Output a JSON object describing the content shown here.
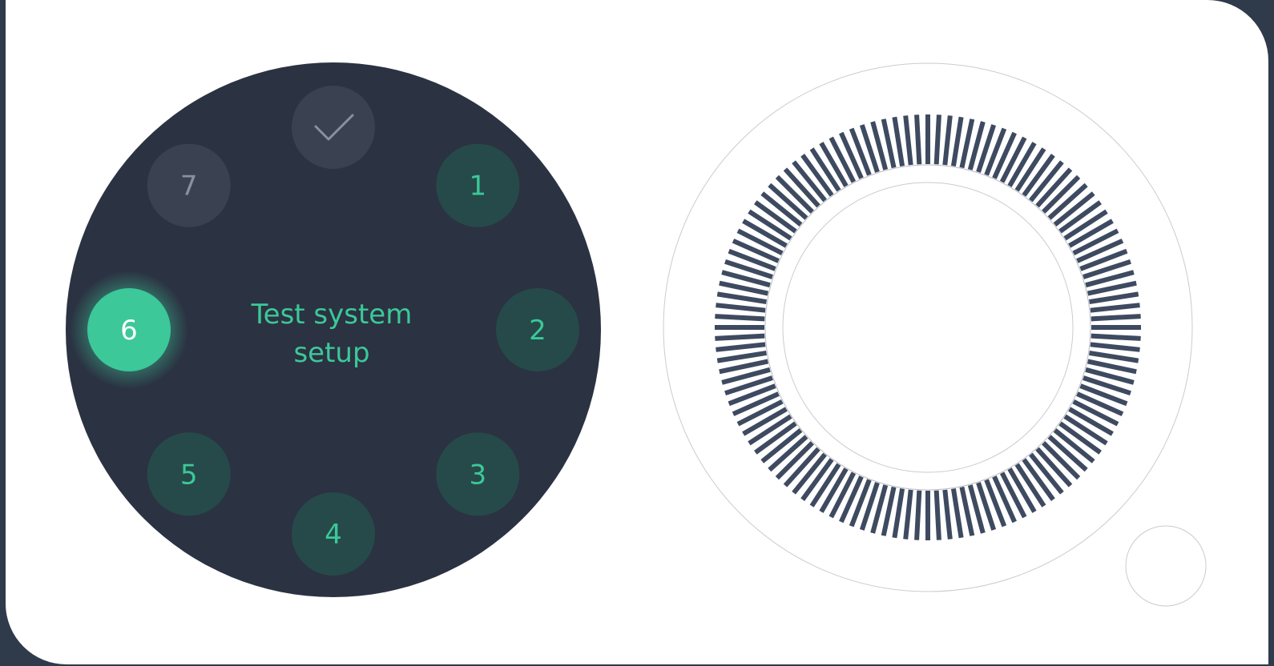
{
  "step_wheel": {
    "title_line_1": "Test system",
    "title_line_2": "setup",
    "confirm_icon": "check-icon",
    "steps": [
      {
        "label": "1",
        "state": "pending"
      },
      {
        "label": "2",
        "state": "pending"
      },
      {
        "label": "3",
        "state": "pending"
      },
      {
        "label": "4",
        "state": "pending"
      },
      {
        "label": "5",
        "state": "pending"
      },
      {
        "label": "6",
        "state": "active"
      },
      {
        "label": "7",
        "state": "disabled"
      }
    ]
  },
  "dial": {
    "tick_count": 120,
    "small_button_icon": "circle-icon"
  },
  "colors": {
    "background": "#2f3a4a",
    "panel": "#ffffff",
    "wheel": "#2b3242",
    "accent": "#3cc898",
    "accent_text": "#3cc898",
    "step_pending_bg": "#264a4a",
    "step_disabled_bg": "#3a4252",
    "tick": "#3e4a60"
  }
}
